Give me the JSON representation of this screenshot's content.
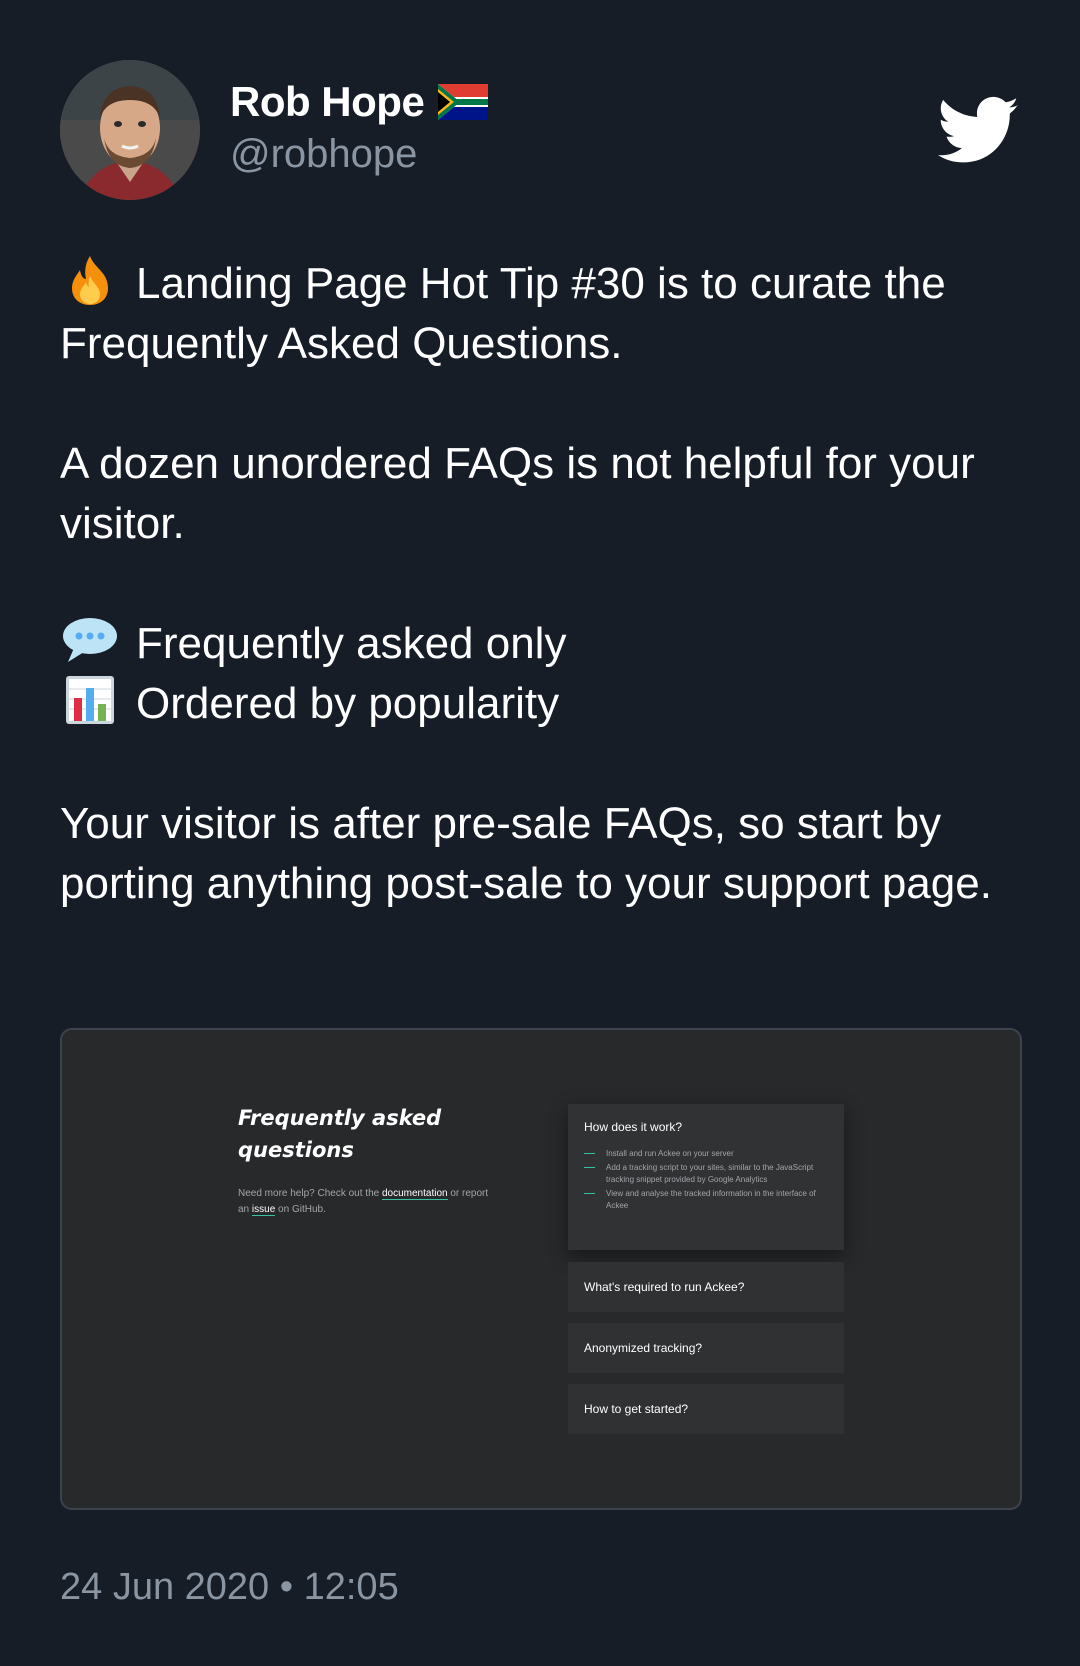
{
  "author": {
    "name": "Rob Hope",
    "handle": "@robhope",
    "flag": "south-africa-flag",
    "avatar": "profile-photo"
  },
  "brand_icon": "twitter-bird-icon",
  "tweet": {
    "line1": "Landing Page Hot Tip #30 is to curate the Frequently Asked Questions.",
    "line2": "A dozen unordered FAQs is not helpful for your visitor.",
    "bullet1": "Frequently asked only",
    "bullet2": "Ordered by popularity",
    "line3": "Your visitor is after pre-sale FAQs, so start by porting anything post-sale to your support page.",
    "emoji_fire": "fire-emoji",
    "emoji_speech": "speech-balloon-emoji",
    "emoji_chart": "bar-chart-emoji"
  },
  "media": {
    "title": "Frequently asked questions",
    "help_prefix": "Need more help? Check out the ",
    "help_link1": "documentation",
    "help_mid": " or report an ",
    "help_link2": "issue",
    "help_suffix": " on GitHub.",
    "faqs": [
      {
        "question": "How does it work?",
        "answers": [
          "Install and run Ackee on your server",
          "Add a tracking script to your sites, similar to the JavaScript tracking snippet provided by Google Analytics",
          "View and analyse the tracked information in the interface of Ackee"
        ]
      },
      {
        "question": "What's required to run Ackee?"
      },
      {
        "question": "Anonymized tracking?"
      },
      {
        "question": "How to get started?"
      }
    ]
  },
  "timestamp": "24 Jun 2020 • 12:05",
  "colors": {
    "background": "#161d27",
    "secondary_text": "#8a95a3",
    "accent": "#35c3a6"
  }
}
